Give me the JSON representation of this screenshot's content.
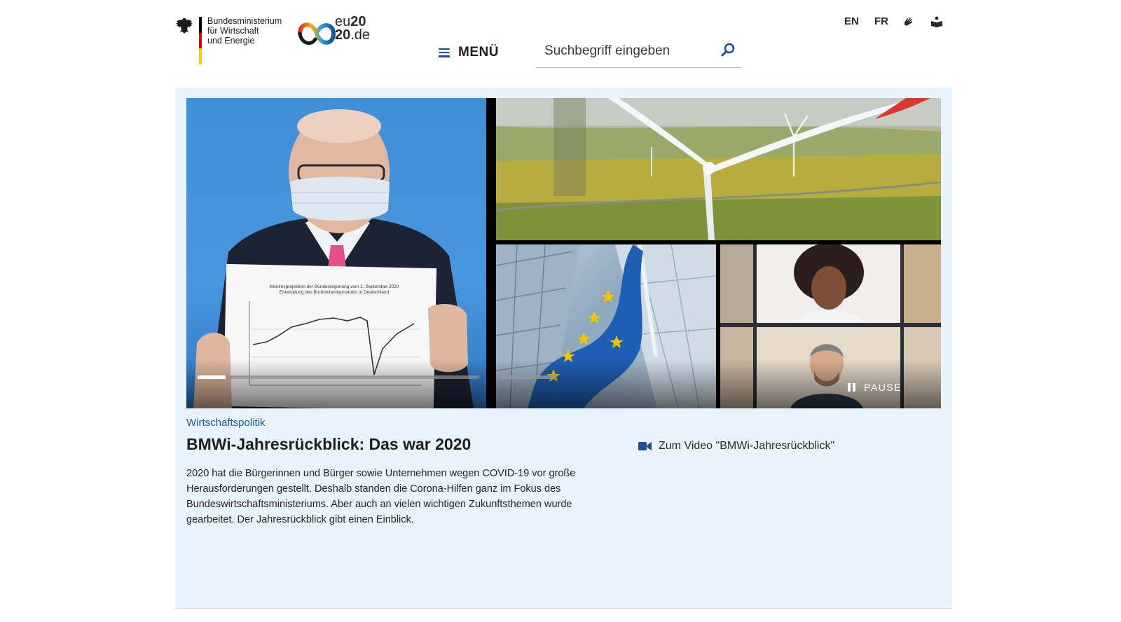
{
  "header": {
    "ministry_lines": [
      "Bundesministerium",
      "für Wirtschaft",
      "und Energie"
    ],
    "eu_logo": {
      "line1_prefix": "eu",
      "line1_bold": "20",
      "line2_bold": "20",
      "line2_suffix": ".de"
    },
    "menu_label": "MENÜ",
    "search_placeholder": "Suchbegriff eingeben",
    "languages": [
      "EN",
      "FR"
    ],
    "tools": [
      "sign-language-icon",
      "easy-language-icon"
    ]
  },
  "stage": {
    "colors": {
      "background": "#e8f4fb",
      "accent": "#1d5aa0",
      "progress_active": "#ffffff",
      "progress_inactive": "#8a8a8a"
    },
    "video": {
      "pause_label": "PAUSE",
      "chart_title_line1": "Interimsprojektion der Bundesregierung vom 1. September 2020",
      "chart_title_line2": "Entwicklung des Bruttoinlandsprodukts in Deutschland",
      "segments": [
        {
          "name": "segment-1",
          "active": true
        },
        {
          "name": "segment-2",
          "active": false
        },
        {
          "name": "segment-3",
          "active": false
        }
      ]
    },
    "category": "Wirtschaftspolitik",
    "headline": "BMWi-Jahresrückblick: Das war 2020",
    "teaser": "2020 hat die Bürgerinnen und Bürger sowie Unternehmen wegen COVID-19 vor große Herausforderungen gestellt. Deshalb standen die Corona-Hilfen ganz im Fokus des Bundeswirtschaftsministeriums. Aber auch an vielen wichtigen Zukunftsthemen wurde gearbeitet. Der Jahresrückblick gibt einen Einblick.",
    "video_link": "Zum Video \"BMWi-Jahresrückblick\""
  }
}
